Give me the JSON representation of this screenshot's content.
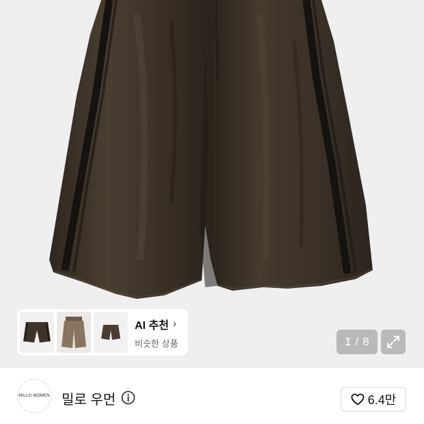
{
  "gallery": {
    "current": "1",
    "separator": "/",
    "total": "8",
    "background": "#efefef"
  },
  "ai_recommend": {
    "title": "AI 추천",
    "chevron": "›",
    "subtitle": "비슷한 상품",
    "thumbnails": [
      "dark-brown-shorts",
      "tan-shorts",
      "brown-shorts-small"
    ]
  },
  "brand": {
    "logo_text": "MILLO WOMEN",
    "name": "밀로 우먼",
    "info_icon": "info-icon"
  },
  "like": {
    "icon": "heart-icon",
    "count": "6.4만"
  },
  "colors": {
    "product": "#3e3327",
    "stripe": "#151210",
    "accent_text": "#111111"
  }
}
